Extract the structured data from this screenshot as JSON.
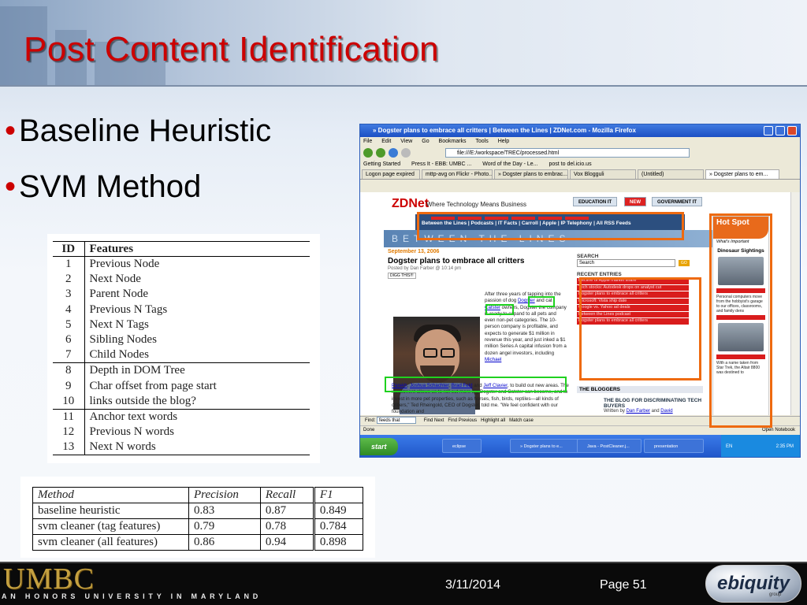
{
  "slide": {
    "title": "Post Content Identification",
    "bullets": [
      "Baseline Heuristic",
      "SVM Method"
    ],
    "bullet_color": "#cc0000",
    "title_color": "#cc0000"
  },
  "features_table": {
    "headers": [
      "ID",
      "Features"
    ],
    "rows": [
      [
        "1",
        "Previous Node"
      ],
      [
        "2",
        "Next Node"
      ],
      [
        "3",
        "Parent Node"
      ],
      [
        "4",
        "Previous N Tags"
      ],
      [
        "5",
        "Next N Tags"
      ],
      [
        "6",
        "Sibling Nodes"
      ],
      [
        "7",
        "Child Nodes"
      ],
      [
        "8",
        "Depth in DOM Tree"
      ],
      [
        "9",
        "Char offset from page start"
      ],
      [
        "10",
        "links outside the blog?"
      ],
      [
        "11",
        "Anchor text words"
      ],
      [
        "12",
        "Previous N words"
      ],
      [
        "13",
        "Next N words"
      ]
    ]
  },
  "results_table": {
    "headers": [
      "Method",
      "Precision",
      "Recall",
      "F1"
    ],
    "rows": [
      [
        "baseline heuristic",
        "0.83",
        "0.87",
        "0.849"
      ],
      [
        "svm cleaner (tag features)",
        "0.79",
        "0.78",
        "0.784"
      ],
      [
        "svm cleaner (all features)",
        "0.86",
        "0.94",
        "0.898"
      ]
    ]
  },
  "browser": {
    "window_title": "» Dogster plans to embrace all critters | Between the Lines | ZDNet.com - Mozilla Firefox",
    "menu": [
      "File",
      "Edit",
      "View",
      "Go",
      "Bookmarks",
      "Tools",
      "Help"
    ],
    "address": "file:///E:/workspace/TREC/processed.html",
    "bookmarks": [
      "Getting Started",
      "Press It - EBB: UMBC ...",
      "Word of the Day - Le...",
      "post to del.icio.us"
    ],
    "tabs": [
      "Logon page expired",
      "mttp-avg on Flickr - Photo...",
      "» Dogster plans to embrac...",
      "Vox Blogguli",
      "(Untitled)",
      "» Dogster plans to em..."
    ],
    "page": {
      "logo": "ZDNet",
      "tagline": "Where Technology Means Business",
      "pill_education": "EDUCATION IT",
      "pill_new": "NEW",
      "pill_government": "GOVERNMENT IT",
      "nav_links": "Between the Lines | Podcasts | IT Facts | Carroll | Apple | IP Telephony | All RSS Feeds",
      "blog_band": "BETWEEN THE LINES",
      "date": "September 13, 2006",
      "post_title": "Dogster plans to embrace all critters",
      "byline": "Posted by Dan Farber @ 10:14 pm",
      "digg": "DIGG THIS!!!",
      "body_a": "After three years of tapping into the passion of dog ",
      "link_dogster": "Dogster",
      "body_b": " and cat ",
      "link_catster": "Catster",
      "body_c": " owners, Dogster the company is ready to expand to all pets and even non-pet categories. The 10-person company is profitable, and expects to generate $1 million in revenue this year, and just inked a $1 million Series A capital infusion from a dozen angel investors, including ",
      "link_michael": "Michael",
      "link_parekh": "Parekh",
      "link_joshua": "Joshua Schachter",
      "link_brad": "Brad Feld",
      "link_jeff": "Jeff Clavier",
      "body_d": ", to build out new areas. The investment allows us to roll out more big Dogster and Catster can become, and to invest in more pet properties, such as horses, fish, birds, reptiles—all kinds of critters,\" Ted Rheingold, CEO of Dogster, told me. \"We feel confident with our foundation and",
      "search_label": "SEARCH",
      "search_placeholder": "Search",
      "go": "GO",
      "recent_label": "RECENT ENTRIES",
      "recent_entries": [
        "Decline of Apple market share",
        "Tech stocks: Autodesk drops on analyst cut",
        "Dogster plans to embrace all critters",
        "Microsoft: Vista ship date",
        "Google vs. Yahoo ad deals",
        "Between the Lines podcast",
        "Dogster plans to embrace all critters"
      ],
      "bloggers_label": "THE BLOGGERS",
      "bloggers_title": "THE BLOG FOR DISCRIMINATING TECH BUYERS",
      "written_by": "Written by ",
      "link_dan": "Dan Farber",
      "and": " and ",
      "link_david": "David",
      "ad_hot": "Hot Spot",
      "ad_what": "What's Important",
      "ad_ds": "Dinosaur Sightings",
      "ad_text1": "Personal computers move from the hobbyist's garage to our offices, classrooms, and family dens",
      "ad_text2": "With a name taken from Star Trek, the Altair 8800 was destined to"
    },
    "find": {
      "label": "Find:",
      "value": "feeds that",
      "next": "Find Next",
      "previous": "Find Previous",
      "highlight": "Highlight all",
      "match_case": "Match case"
    },
    "status_left": "Done",
    "status_right": "Open Notebook",
    "taskbar": {
      "start": "start",
      "buttons": [
        "eclipse",
        "» Dogster plans to e...",
        "Java - PostCleaner.j...",
        "presentation"
      ],
      "lang": "EN",
      "clock": "2:35 PM"
    }
  },
  "footer": {
    "org": "UMBC",
    "motto": "AN HONORS UNIVERSITY IN MARYLAND",
    "date": "3/11/2014",
    "page": "Page 51",
    "logo": "ebiquity",
    "logo_sub": "group"
  }
}
